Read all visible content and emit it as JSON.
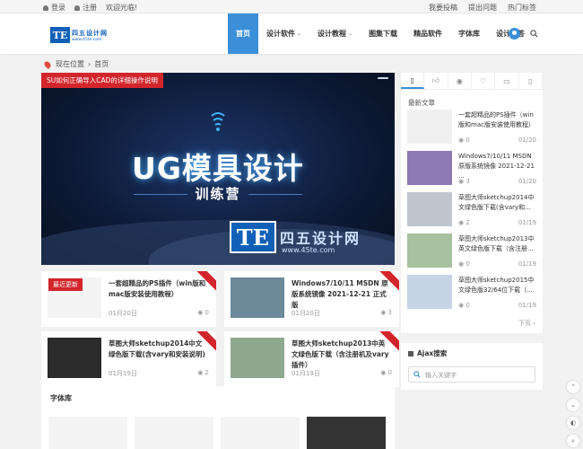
{
  "topbar": {
    "login": "登录",
    "register": "注册",
    "welcome": "欢迎光临!",
    "contribute": "我要投稿",
    "ask": "提出问题",
    "hot_tags": "热门标签"
  },
  "header": {
    "logo_te": "TE",
    "logo_cn": "四五设计网",
    "logo_en": "www.45te.com",
    "nav": [
      {
        "label": "首页",
        "active": true,
        "caret": false
      },
      {
        "label": "设计软件",
        "active": false,
        "caret": true
      },
      {
        "label": "设计教程",
        "active": false,
        "caret": true
      },
      {
        "label": "图集下载",
        "active": false,
        "caret": false
      },
      {
        "label": "精品软件",
        "active": false,
        "caret": false
      },
      {
        "label": "字体库",
        "active": false,
        "caret": false
      },
      {
        "label": "设计问答",
        "active": false,
        "caret": false
      }
    ]
  },
  "breadcrumb": {
    "prefix": "现在位置",
    "sep": "›",
    "current": "首页"
  },
  "slider": {
    "caption": "SU如何正确导入CAD的详细操作说明",
    "title": "UG模具设计",
    "subtitle": "训练营",
    "wm_te": "TE",
    "wm_cn": "四五设计网",
    "wm_en": "www.45te.com"
  },
  "cards": [
    {
      "title": "一套超精品的PS插件（win版和mac版安装使用教程）",
      "date": "01月20日",
      "views": "0",
      "tag": "最近更新"
    },
    {
      "title": "Windows7/10/11 MSDN 原版系统镜像 2021-12-21 正式版",
      "date": "01月20日",
      "views": "3",
      "tag": ""
    },
    {
      "title": "草图大师sketchup2014中文绿色版下载(含vary和安装说明)",
      "date": "01月19日",
      "views": "2",
      "tag": ""
    },
    {
      "title": "草图大师sketchup2013中英文绿色版下载（含注册机及vary插件）",
      "date": "01月19日",
      "views": "0",
      "tag": ""
    }
  ],
  "font_section": {
    "heading": "字体库"
  },
  "sidebar": {
    "heading": "最新文章",
    "posts": [
      {
        "title": "一套超精品的PS插件（win版和mac版安装使用教程）",
        "views": "0",
        "date": "01/20"
      },
      {
        "title": "Windows7/10/11 MSDN 原版系统镜像 2021-12-21 ...",
        "views": "3",
        "date": "01/20"
      },
      {
        "title": "草图大师sketchup2014中文绿色版下载(含vary和...",
        "views": "2",
        "date": "01/19"
      },
      {
        "title": "草图大师sketchup2013中英文绿色版下载（含注册...",
        "views": "0",
        "date": "01/19"
      },
      {
        "title": "草图大师sketchup2015中文绿色版32/64位下载（...",
        "views": "0",
        "date": "01/19"
      }
    ],
    "next": "下页 ›"
  },
  "ajax": {
    "heading": "Ajax搜索",
    "placeholder": "输入关键字"
  },
  "colors": {
    "accent": "#3a8fd8",
    "red": "#d3252c",
    "brand": "#1160b7"
  }
}
